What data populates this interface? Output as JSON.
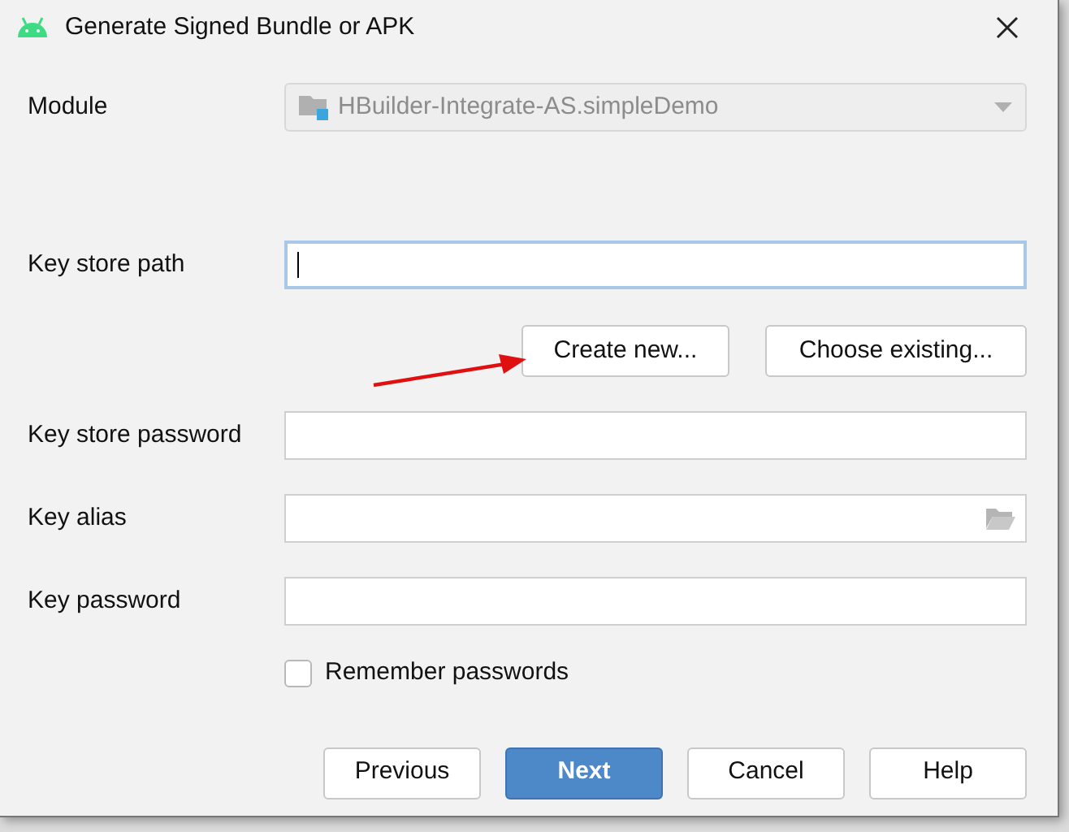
{
  "window": {
    "title": "Generate Signed Bundle or APK"
  },
  "module": {
    "label": "Module",
    "value": "HBuilder-Integrate-AS.simpleDemo",
    "disabled": true
  },
  "key_store_path": {
    "label": "Key store path",
    "focused": true
  },
  "key_store_buttons": [
    "Create new...",
    "Choose existing..."
  ],
  "fields": [
    {
      "label": "Key store password",
      "kind": "text"
    },
    {
      "label": "Key alias",
      "kind": "browse"
    },
    {
      "label": "Key password",
      "kind": "text"
    }
  ],
  "remember_passwords": {
    "label": "Remember passwords",
    "checked": false
  },
  "buttons": [
    {
      "label": "Previous",
      "primary": false
    },
    {
      "label": "Next",
      "primary": true
    },
    {
      "label": "Cancel",
      "primary": false
    },
    {
      "label": "Help",
      "primary": false
    }
  ]
}
